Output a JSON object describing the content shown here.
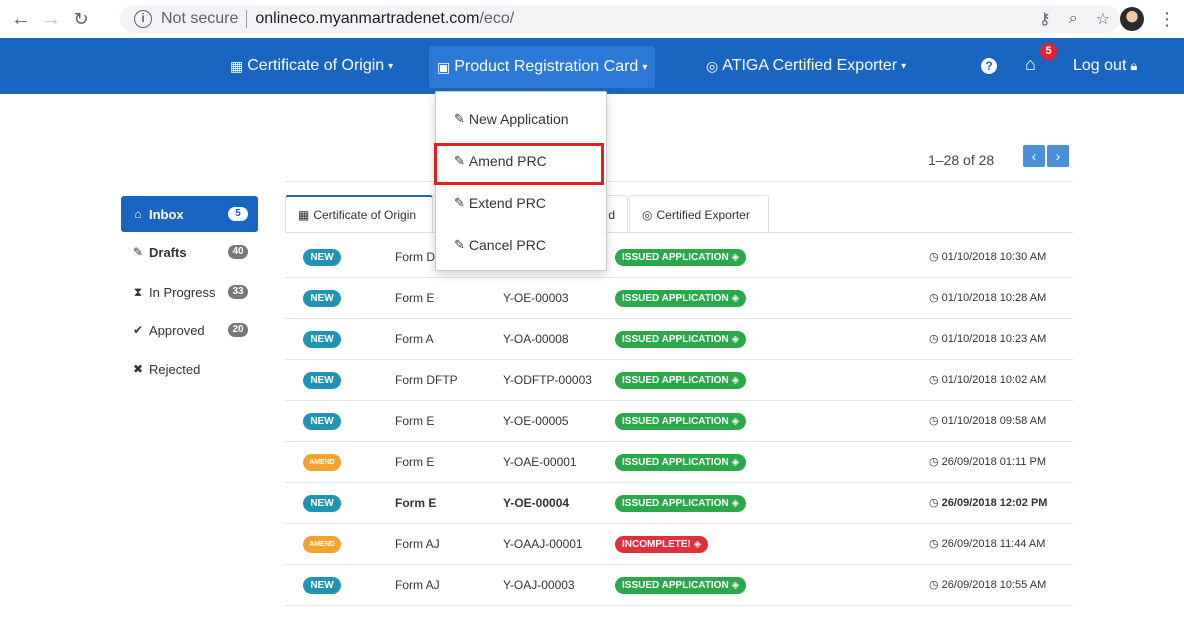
{
  "browser": {
    "security_label": "Not secure",
    "url_host": "onlineco.myanmartradenet.com",
    "url_path": "/eco/"
  },
  "navbar": {
    "items": [
      {
        "label": "Certificate of Origin",
        "icon": "certificate-icon"
      },
      {
        "label": "Product Registration Card",
        "icon": "id-card-icon"
      },
      {
        "label": "ATIGA Certified Exporter",
        "icon": "badge-icon"
      }
    ],
    "home_badge": "5",
    "logout_label": "Log out"
  },
  "dropdown": {
    "items": [
      {
        "label": "New Application"
      },
      {
        "label": "Amend PRC"
      },
      {
        "label": "Extend PRC"
      },
      {
        "label": "Cancel PRC"
      }
    ]
  },
  "pager": {
    "text": "1–28 of 28"
  },
  "sidebar": {
    "items": [
      {
        "label": "Inbox",
        "badge": "5",
        "icon": "inbox-icon"
      },
      {
        "label": "Drafts",
        "badge": "40",
        "icon": "edit-icon"
      },
      {
        "label": "In Progress",
        "badge": "33",
        "icon": "hourglass-icon"
      },
      {
        "label": "Approved",
        "badge": "20",
        "icon": "check-circle-icon"
      },
      {
        "label": "Rejected",
        "badge": "",
        "icon": "times-circle-icon"
      }
    ]
  },
  "tabs": [
    {
      "label": "Certificate of Origin"
    },
    {
      "label": "d"
    },
    {
      "label": "Certified Exporter"
    }
  ],
  "rows": [
    {
      "tag": "NEW",
      "form": "Form D",
      "ref": "",
      "status": "ISSUED APPLICATION",
      "time": "01/10/2018 10:30 AM"
    },
    {
      "tag": "NEW",
      "form": "Form E",
      "ref": "Y-OE-00003",
      "status": "ISSUED APPLICATION",
      "time": "01/10/2018 10:28 AM"
    },
    {
      "tag": "NEW",
      "form": "Form A",
      "ref": "Y-OA-00008",
      "status": "ISSUED APPLICATION",
      "time": "01/10/2018 10:23 AM"
    },
    {
      "tag": "NEW",
      "form": "Form DFTP",
      "ref": "Y-ODFTP-00003",
      "status": "ISSUED APPLICATION",
      "time": "01/10/2018 10:02 AM"
    },
    {
      "tag": "NEW",
      "form": "Form E",
      "ref": "Y-OE-00005",
      "status": "ISSUED APPLICATION",
      "time": "01/10/2018 09:58 AM"
    },
    {
      "tag": "AMEND",
      "form": "Form E",
      "ref": "Y-OAE-00001",
      "status": "ISSUED APPLICATION",
      "time": "26/09/2018 01:11 PM"
    },
    {
      "tag": "NEW",
      "form": "Form E",
      "ref": "Y-OE-00004",
      "status": "ISSUED APPLICATION",
      "time": "26/09/2018 12:02 PM"
    },
    {
      "tag": "AMEND",
      "form": "Form AJ",
      "ref": "Y-OAAJ-00001",
      "status": "INCOMPLETE!",
      "time": "26/09/2018 11:44 AM"
    },
    {
      "tag": "NEW",
      "form": "Form AJ",
      "ref": "Y-OAJ-00003",
      "status": "ISSUED APPLICATION",
      "time": "26/09/2018 10:55 AM"
    }
  ]
}
